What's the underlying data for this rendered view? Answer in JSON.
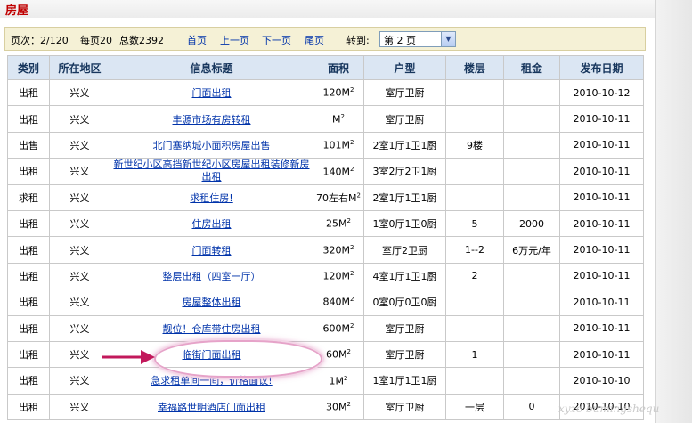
{
  "header": {
    "title": "房屋"
  },
  "pager": {
    "page_label": "页次：2/120",
    "per_page": "每页20",
    "total": "总数2392",
    "first": "首页",
    "prev": "上一页",
    "next": "下一页",
    "last": "尾页",
    "goto_label": "转到:",
    "goto_selected": "第 2 页"
  },
  "table": {
    "headers": [
      "类别",
      "所在地区",
      "信息标题",
      "面积",
      "户型",
      "楼层",
      "租金",
      "发布日期"
    ],
    "rows": [
      {
        "type": "出租",
        "area": "兴义",
        "title": "门面出租",
        "size": "120M",
        "layout": "室厅卫厨",
        "floor": "",
        "rent": "",
        "date": "2010-10-12"
      },
      {
        "type": "出租",
        "area": "兴义",
        "title": "丰源市场有房转租",
        "size": "M",
        "layout": "室厅卫厨",
        "floor": "",
        "rent": "",
        "date": "2010-10-11"
      },
      {
        "type": "出售",
        "area": "兴义",
        "title": "北门塞纳城小面积房屋出售",
        "size": "101M",
        "layout": "2室1厅1卫1厨",
        "floor": "9楼",
        "rent": "",
        "date": "2010-10-11"
      },
      {
        "type": "出租",
        "area": "兴义",
        "title": "新世纪小区高挡新世纪小区房屋出租装修新房出租",
        "size": "140M",
        "layout": "3室2厅2卫1厨",
        "floor": "",
        "rent": "",
        "date": "2010-10-11"
      },
      {
        "type": "求租",
        "area": "兴义",
        "title": "求租住房!",
        "size": "70左右M",
        "layout": "2室1厅1卫1厨",
        "floor": "",
        "rent": "",
        "date": "2010-10-11"
      },
      {
        "type": "出租",
        "area": "兴义",
        "title": "住房出租",
        "size": "25M",
        "layout": "1室0厅1卫0厨",
        "floor": "5",
        "rent": "2000",
        "date": "2010-10-11"
      },
      {
        "type": "出租",
        "area": "兴义",
        "title": "门面转租",
        "size": "320M",
        "layout": "室厅2卫厨",
        "floor": "1--2",
        "rent": "6万元/年",
        "date": "2010-10-11"
      },
      {
        "type": "出租",
        "area": "兴义",
        "title": "整层出租（四室一厅）",
        "size": "120M",
        "layout": "4室1厅1卫1厨",
        "floor": "2",
        "rent": "",
        "date": "2010-10-11"
      },
      {
        "type": "出租",
        "area": "兴义",
        "title": "房屋整体出租",
        "size": "840M",
        "layout": "0室0厅0卫0厨",
        "floor": "",
        "rent": "",
        "date": "2010-10-11"
      },
      {
        "type": "出租",
        "area": "兴义",
        "title": "靓位！仓库带住房出租",
        "size": "600M",
        "layout": "室厅卫厨",
        "floor": "",
        "rent": "",
        "date": "2010-10-11"
      },
      {
        "type": "出租",
        "area": "兴义",
        "title": "临街门面出租",
        "size": "60M",
        "layout": "室厅卫厨",
        "floor": "1",
        "rent": "",
        "date": "2010-10-11"
      },
      {
        "type": "出租",
        "area": "兴义",
        "title": "急求租单间一间，价格面议!",
        "size": "1M",
        "layout": "1室1厅1卫1厨",
        "floor": "",
        "rent": "",
        "date": "2010-10-10"
      },
      {
        "type": "出租",
        "area": "兴义",
        "title": "幸福路世明酒店门面出租",
        "size": "30M",
        "layout": "室厅卫厨",
        "floor": "一层",
        "rent": "0",
        "date": "2010-10-10"
      }
    ]
  },
  "watermark": "xyzo bumingshequ",
  "colors": {
    "header_bg": "#dbe6f3",
    "pager_bg": "#f5f1d6",
    "title_red": "#c00000",
    "link": "#0033aa",
    "highlight": "#e6a3c9"
  }
}
